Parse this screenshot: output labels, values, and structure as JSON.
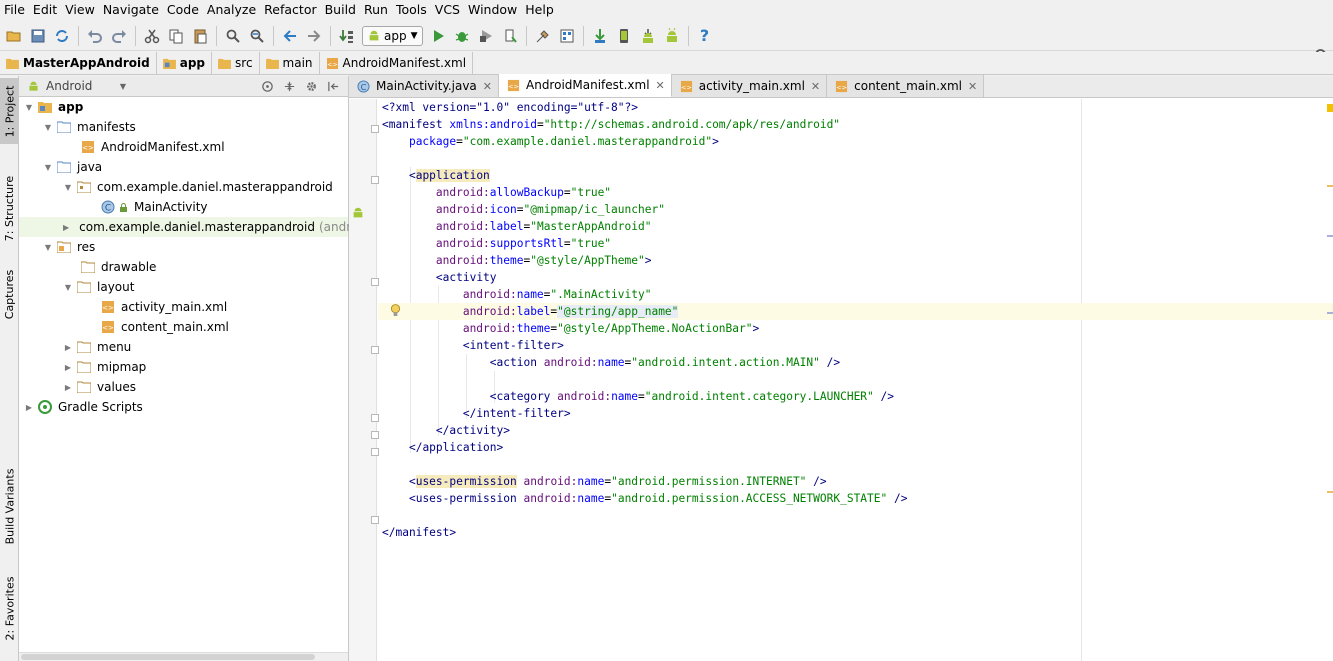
{
  "menubar": {
    "items": [
      "File",
      "Edit",
      "View",
      "Navigate",
      "Code",
      "Analyze",
      "Refactor",
      "Build",
      "Run",
      "Tools",
      "VCS",
      "Window",
      "Help"
    ]
  },
  "toolbar": {
    "run_config": "app",
    "icons": [
      "open-folder-icon",
      "save-icon",
      "sync-icon",
      "undo-icon",
      "redo-icon",
      "cut-icon",
      "copy-icon",
      "paste-icon",
      "find-icon",
      "replace-icon",
      "back-icon",
      "forward-icon",
      "make-icon",
      "run-icon",
      "debug-icon",
      "coverage-icon",
      "attach-icon",
      "structure-icon",
      "project-structure-icon",
      "sdk-download-icon",
      "avd-icon",
      "sdk-manager-icon",
      "android-monitor-icon",
      "help-icon"
    ]
  },
  "breadcrumb": {
    "items": [
      "MasterAppAndroid",
      "app",
      "src",
      "main",
      "AndroidManifest.xml"
    ]
  },
  "left_tool_tabs": [
    "1: Project",
    "7: Structure",
    "Captures",
    "Build Variants",
    "2: Favorites"
  ],
  "project_panel": {
    "view_mode": "Android",
    "tree": [
      {
        "label": "app",
        "bold": true
      },
      {
        "label": "manifests"
      },
      {
        "label": "AndroidManifest.xml"
      },
      {
        "label": "java"
      },
      {
        "label": "com.example.daniel.masterappandroid"
      },
      {
        "label": "MainActivity"
      },
      {
        "label": "com.example.daniel.masterappandroid",
        "suffix": "(androi"
      },
      {
        "label": "res"
      },
      {
        "label": "drawable"
      },
      {
        "label": "layout"
      },
      {
        "label": "activity_main.xml"
      },
      {
        "label": "content_main.xml"
      },
      {
        "label": "menu"
      },
      {
        "label": "mipmap"
      },
      {
        "label": "values"
      },
      {
        "label": "Gradle Scripts"
      }
    ]
  },
  "editor": {
    "tabs": [
      {
        "label": "MainActivity.java",
        "active": false
      },
      {
        "label": "AndroidManifest.xml",
        "active": true
      },
      {
        "label": "activity_main.xml",
        "active": false
      },
      {
        "label": "content_main.xml",
        "active": false
      }
    ],
    "code": {
      "l1_decl": "<?xml version=\"1.0\" encoding=\"utf-8\"?>",
      "manifest_open": "<manifest",
      "xmlns_name": "xmlns:android",
      "xmlns_val": "\"http://schemas.android.com/apk/res/android\"",
      "package_name": "package",
      "package_val": "\"com.example.daniel.masterappandroid\"",
      "application": "application",
      "allowBackup_name": "allowBackup",
      "allowBackup_val": "\"true\"",
      "icon_name": "icon",
      "icon_val": "\"@mipmap/ic_launcher\"",
      "label_name": "label",
      "label_val": "\"MasterAppAndroid\"",
      "rtl_name": "supportsRtl",
      "rtl_val": "\"true\"",
      "theme_name": "theme",
      "theme_val": "\"@style/AppTheme\"",
      "activity": "activity",
      "act_name_val": "\".MainActivity\"",
      "act_label_val": "\"@string/app_name\"",
      "act_theme_val": "\"@style/AppTheme.NoActionBar\"",
      "intent_filter": "intent-filter",
      "action": "action",
      "action_val": "\"android.intent.action.MAIN\"",
      "category": "category",
      "category_val": "\"android.intent.category.LAUNCHER\"",
      "uses_permission": "uses-permission",
      "perm1_val": "\"android.permission.INTERNET\"",
      "perm2_val": "\"android.permission.ACCESS_NETWORK_STATE\"",
      "manifest_close": "</manifest>",
      "ns": "android:",
      "name_attr": "name"
    }
  },
  "colors": {
    "tag": "#000080",
    "attribute": "#0000ff",
    "namespace": "#660e7a",
    "value": "#008000",
    "android_green": "#a4c639",
    "folder": "#7fa8d6"
  }
}
